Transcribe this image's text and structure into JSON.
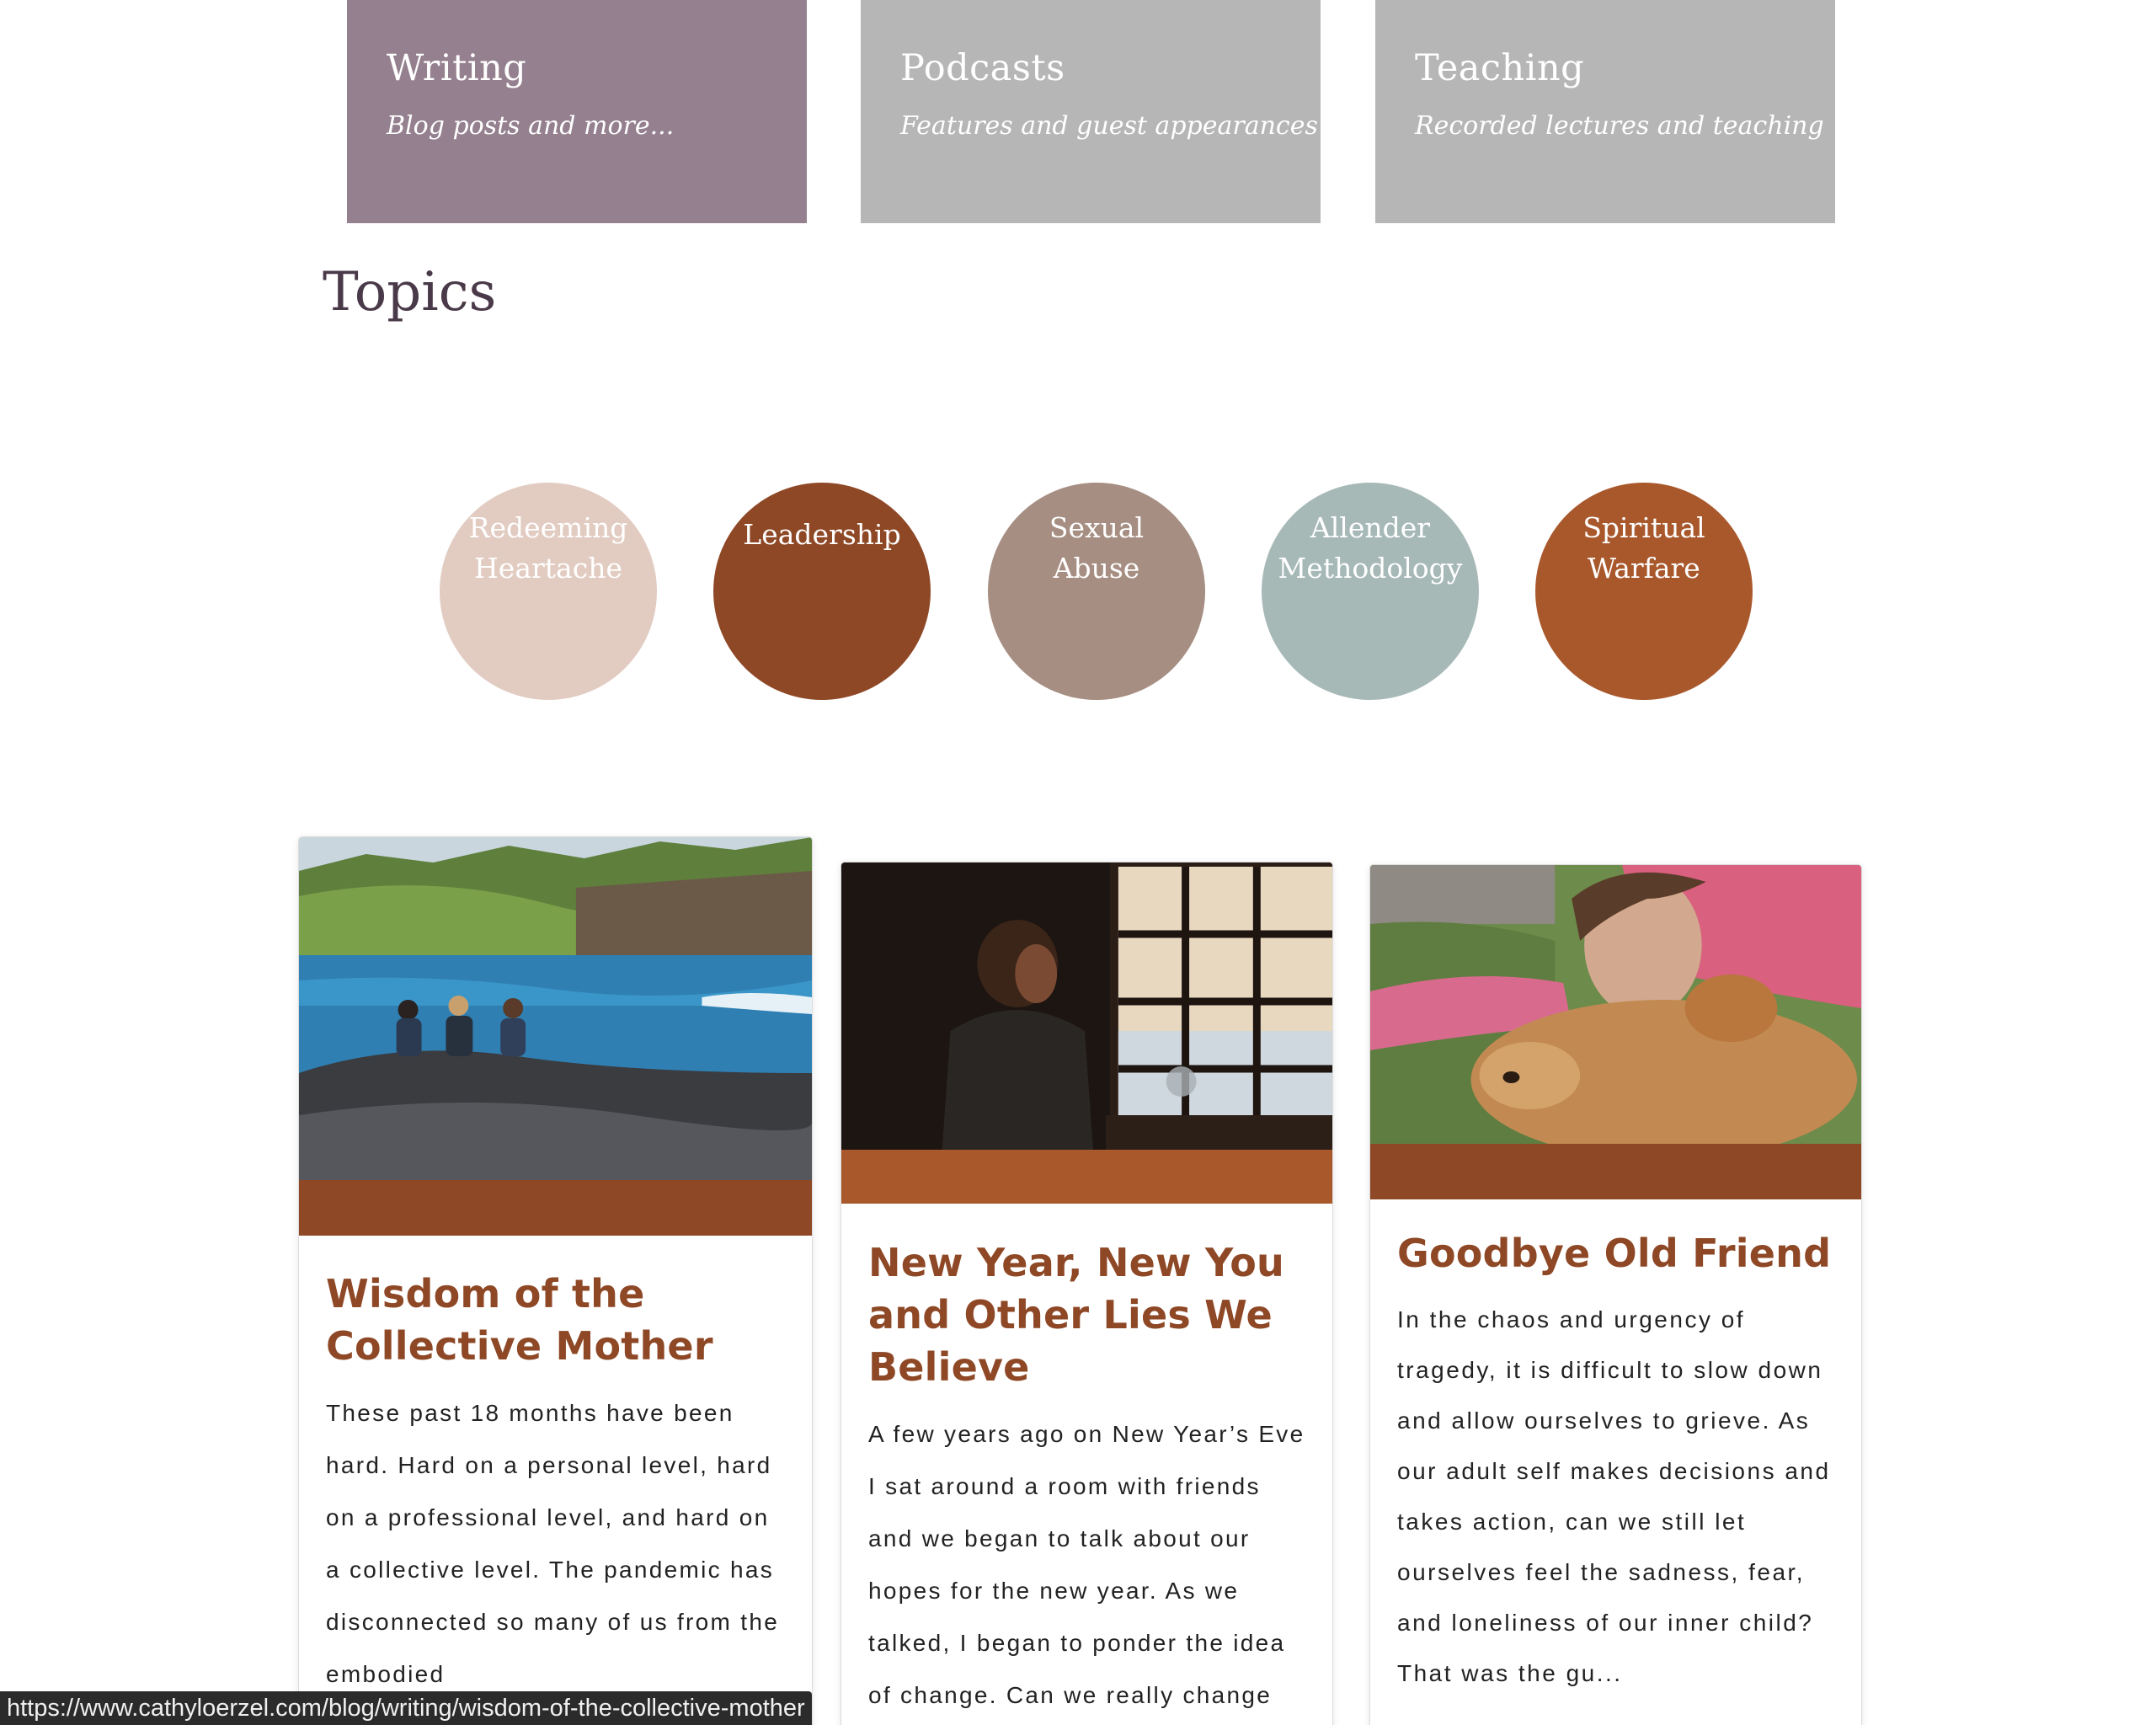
{
  "nav_tiles": [
    {
      "title": "Writing",
      "subtitle": "Blog posts and more...",
      "color": "#95808f"
    },
    {
      "title": "Podcasts",
      "subtitle": "Features and guest appearances",
      "color": "#b6b6b6"
    },
    {
      "title": "Teaching",
      "subtitle": "Recorded lectures and teaching",
      "color": "#b6b6b6"
    }
  ],
  "topics": {
    "heading": "Topics",
    "items": [
      {
        "line1": "Redeeming",
        "line2": "Heartache",
        "color": "#e2ccc2"
      },
      {
        "line1": "Leadership",
        "line2": "",
        "color": "#8e4826"
      },
      {
        "line1": "Sexual",
        "line2": "Abuse",
        "color": "#a68e82"
      },
      {
        "line1": "Allender",
        "line2": "Methodology",
        "color": "#a7b9b7"
      },
      {
        "line1": "Spiritual",
        "line2": "Warfare",
        "color": "#a9582c"
      }
    ]
  },
  "posts": [
    {
      "title": "Wisdom of the Collective Mother",
      "excerpt": "These past 18 months have been hard. Hard on a personal level, hard on a professional level, and hard on a collective level. The pandemic has disconnected so many of us from the embodied",
      "bar_color": "#8e4826",
      "image": "three-women-sitting-on-coastal-rocks"
    },
    {
      "title": "New Year, New You and Other Lies We Believe",
      "excerpt": "A few years ago on New Year’s Eve I sat around a room with friends and we began to talk about our hopes for the new year. As we talked, I began to ponder the idea of change. Can we really change after a certain point or",
      "bar_color": "#a9582c",
      "image": "woman-looking-out-window"
    },
    {
      "title": "Goodbye Old Friend",
      "excerpt": "In the chaos and urgency of tragedy, it is difficult to slow down and allow ourselves to grieve. As our adult self makes decisions and takes action, can we still let ourselves feel the sadness, fear, and loneliness of our inner child? That was the gu...",
      "bar_color": "#8e4826",
      "image": "woman-lying-on-grass-with-dog"
    }
  ],
  "status_bar": {
    "url": "https://www.cathyloerzel.com/blog/writing/wisdom-of-the-collective-mother"
  }
}
